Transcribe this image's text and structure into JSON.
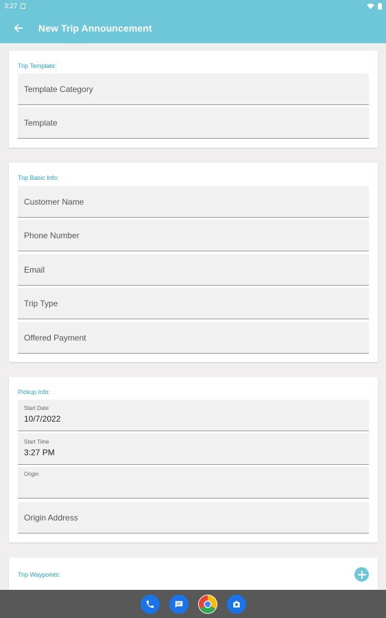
{
  "status_bar": {
    "time": "3:27"
  },
  "app_bar": {
    "title": "New Trip Announcement"
  },
  "trip_template": {
    "title": "Trip Template:",
    "fields": {
      "template_category": "Template Category",
      "template": "Template"
    }
  },
  "trip_basic_info": {
    "title": "Trip Basic Info:",
    "fields": {
      "customer_name": "Customer Name",
      "phone_number": "Phone Number",
      "email": "Email",
      "trip_type": "Trip Type",
      "offered_payment": "Offered Payment"
    }
  },
  "pickup_info": {
    "title": "Pickup Info:",
    "start_date": {
      "label": "Start Date",
      "value": "10/7/2022"
    },
    "start_time": {
      "label": "Start Time",
      "value": "3:27 PM"
    },
    "origin": {
      "label": "Origin"
    },
    "origin_address": "Origin Address"
  },
  "trip_waypoints": {
    "title": "Trip Waypoints:"
  },
  "dock": {
    "apps": [
      "phone-icon",
      "messages-icon",
      "chrome-icon",
      "camera-icon"
    ]
  },
  "colors": {
    "accent": "#6ec6d9",
    "section_title": "#29a3c2",
    "nav_bar": "#585858"
  }
}
